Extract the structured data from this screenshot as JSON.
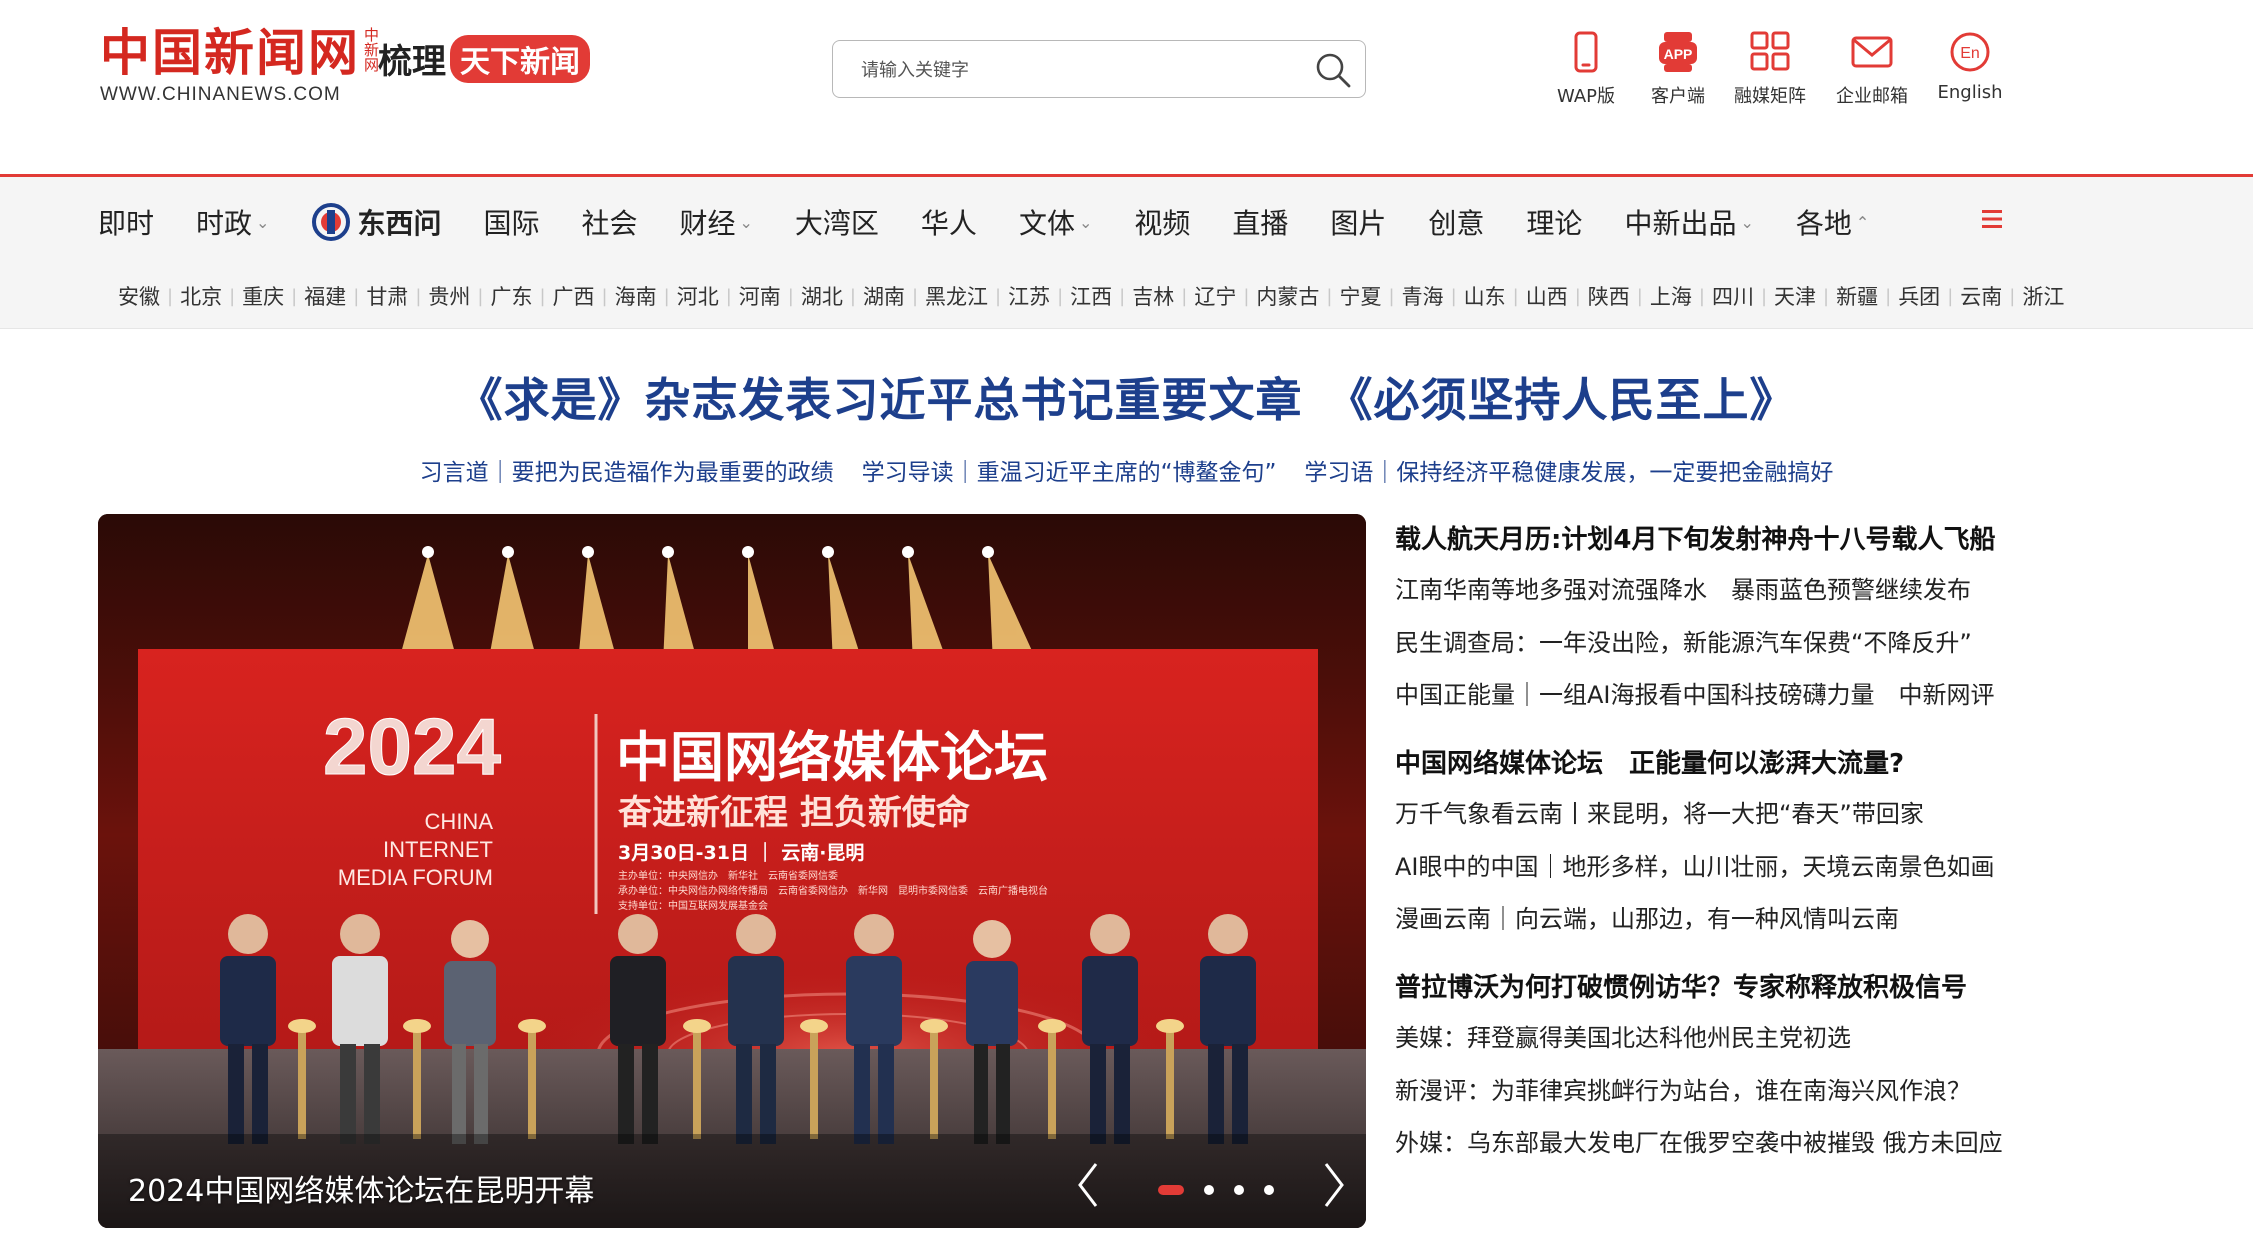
{
  "header": {
    "logo_text": "中国新闻网",
    "logo_side": "中新网",
    "logo_url_text": "WWW.CHINANEWS.COM",
    "slogan_a": "梳理",
    "slogan_b": "天下新闻",
    "search_placeholder": "请输入关键字",
    "tools": [
      {
        "label": "WAP版",
        "icon": "phone-icon"
      },
      {
        "label": "客户端",
        "icon": "app-icon"
      },
      {
        "label": "融媒矩阵",
        "icon": "grid-icon"
      },
      {
        "label": "企业邮箱",
        "icon": "mail-icon"
      },
      {
        "label": "English",
        "icon": "english-icon"
      }
    ],
    "accent_color": "#e23b36"
  },
  "nav": {
    "items": [
      {
        "label": "即时"
      },
      {
        "label": "时政"
      },
      {
        "label": "东西问"
      },
      {
        "label": "国际"
      },
      {
        "label": "社会"
      },
      {
        "label": "财经"
      },
      {
        "label": "大湾区"
      },
      {
        "label": "华人"
      },
      {
        "label": "文体"
      },
      {
        "label": "视频"
      },
      {
        "label": "直播"
      },
      {
        "label": "图片"
      },
      {
        "label": "创意"
      },
      {
        "label": "理论"
      },
      {
        "label": "中新出品"
      },
      {
        "label": "各地"
      }
    ],
    "regions": [
      "安徽",
      "北京",
      "重庆",
      "福建",
      "甘肃",
      "贵州",
      "广东",
      "广西",
      "海南",
      "河北",
      "河南",
      "湖北",
      "湖南",
      "黑龙江",
      "江苏",
      "江西",
      "吉林",
      "辽宁",
      "内蒙古",
      "宁夏",
      "青海",
      "山东",
      "山西",
      "陕西",
      "上海",
      "四川",
      "天津",
      "新疆",
      "兵团",
      "云南",
      "浙江"
    ]
  },
  "headline": {
    "title": "《求是》杂志发表习近平总书记重要文章　《必须坚持人民至上》",
    "links": [
      "习言道｜要把为民造福作为最重要的政绩",
      "学习导读｜重温习近平主席的“博鳌金句”",
      "学习语｜保持经济平稳健康发展，一定要把金融搞好"
    ]
  },
  "carousel": {
    "caption": "2024中国网络媒体论坛在昆明开幕",
    "stage": {
      "year": "2024",
      "title": "中国网络媒体论坛",
      "slogan": "奋进新征程 担负新使命",
      "en_line1": "CHINA",
      "en_line2": "INTERNET",
      "en_line3": "MEDIA FORUM",
      "date_place": "3月30日-31日 ｜ 云南·昆明",
      "organizer": "主办单位：中央网信办　新华社　云南省委网信委",
      "co_organizer": "承办单位：中央网信办网络传播局　云南省委网信办　新华网　昆明市委网信委　云南广播电视台",
      "supporter": "支持单位：中国互联网发展基金会"
    },
    "slide_count": 4,
    "active_slide": 1
  },
  "news": {
    "groups": [
      {
        "title": "载人航天月历:计划4月下旬发射神舟十八号载人飞船",
        "items": [
          "江南华南等地多强对流强降水　暴雨蓝色预警继续发布",
          "民生调查局：一年没出险，新能源汽车保费“不降反升”",
          "中国正能量｜一组AI海报看中国科技磅礴力量　中新网评"
        ]
      },
      {
        "title": "中国网络媒体论坛　正能量何以澎湃大流量?",
        "items": [
          "万千气象看云南丨来昆明，将一大把“春天”带回家",
          "AI眼中的中国｜地形多样，山川壮丽，天境云南景色如画",
          "漫画云南｜向云端，山那边，有一种风情叫云南"
        ]
      },
      {
        "title": "普拉博沃为何打破惯例访华？专家称释放积极信号",
        "items": [
          "美媒：拜登赢得美国北达科他州民主党初选",
          "新漫评：为菲律宾挑衅行为站台，谁在南海兴风作浪？",
          "外媒：乌东部最大发电厂在俄罗空袭中被摧毁 俄方未回应"
        ]
      }
    ]
  }
}
